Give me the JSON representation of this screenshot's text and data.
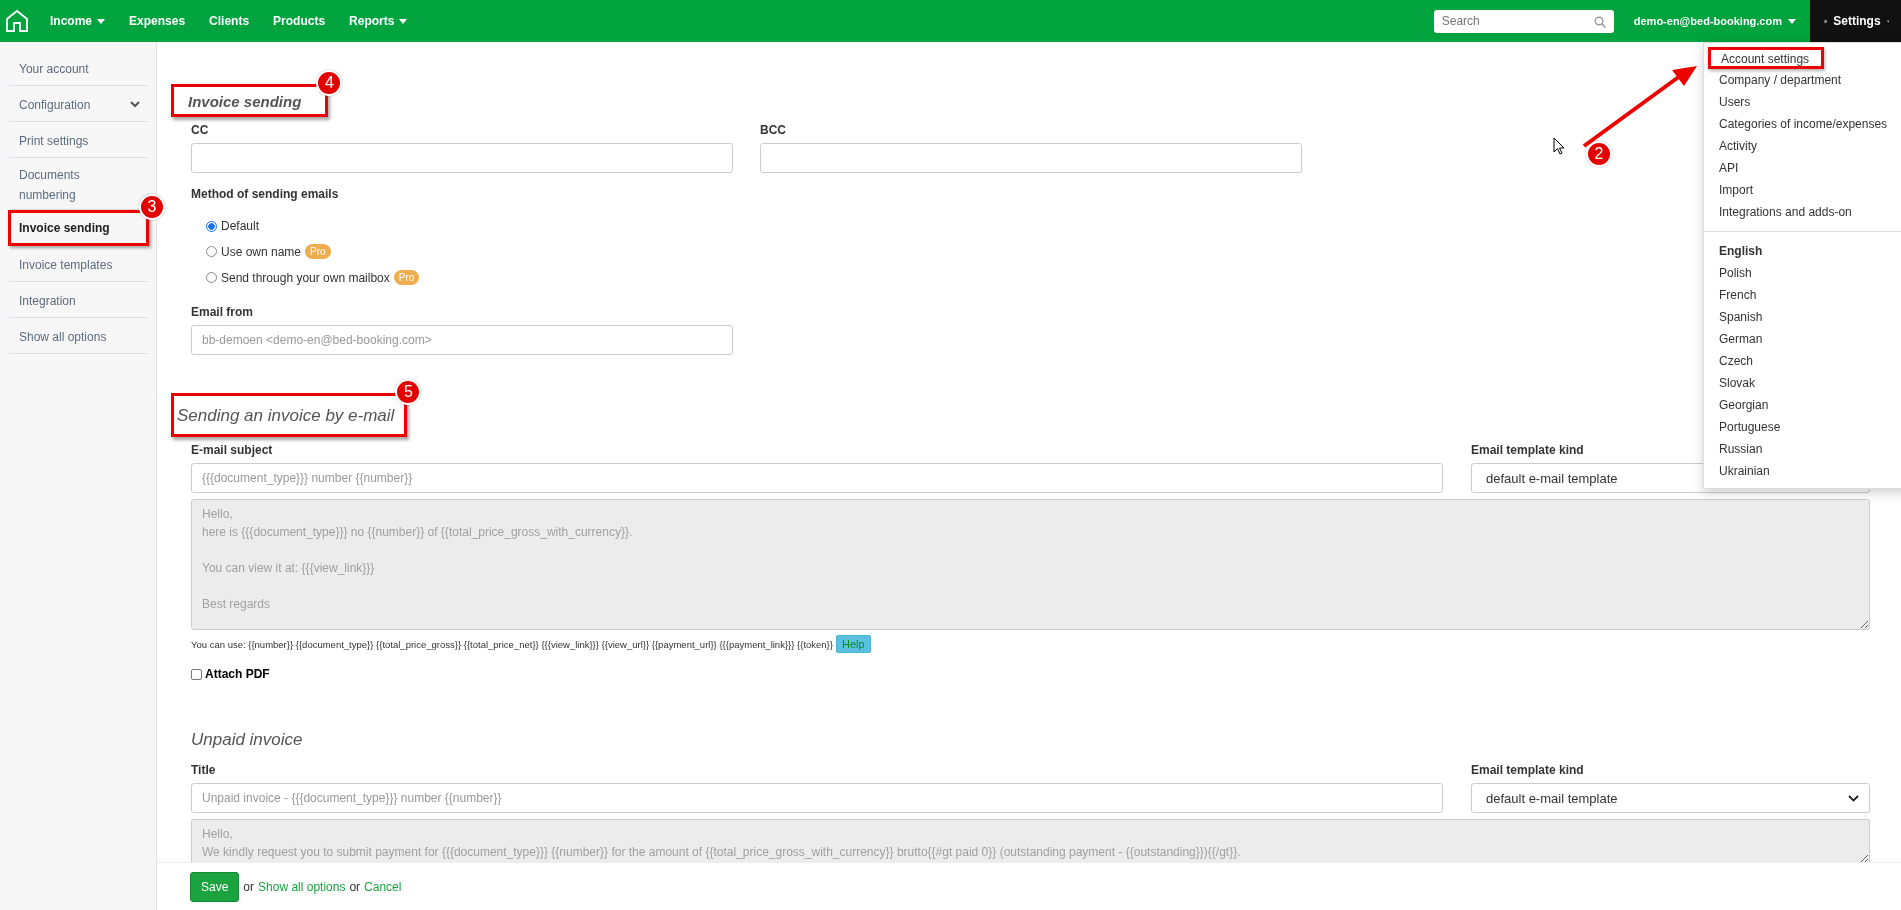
{
  "topbar": {
    "nav": [
      {
        "label": "Income",
        "has_menu": true
      },
      {
        "label": "Expenses",
        "has_menu": false
      },
      {
        "label": "Clients",
        "has_menu": false
      },
      {
        "label": "Products",
        "has_menu": false
      },
      {
        "label": "Reports",
        "has_menu": true
      }
    ],
    "search": {
      "placeholder": "Search"
    },
    "user": {
      "label": "demo-en@bed-booking.com"
    },
    "settings": {
      "label": "Settings",
      "expanded": true
    }
  },
  "settings_menu": {
    "items": [
      {
        "label": "Account settings",
        "callout": "2"
      },
      {
        "label": "Company / department"
      },
      {
        "label": "Users"
      },
      {
        "label": "Categories of income/expenses"
      },
      {
        "label": "Activity"
      },
      {
        "label": "API"
      },
      {
        "label": "Import"
      },
      {
        "label": "Integrations and adds-on"
      }
    ],
    "languages": [
      {
        "label": "English",
        "selected": true
      },
      {
        "label": "Polish",
        "selected": false
      },
      {
        "label": "French",
        "selected": false
      },
      {
        "label": "Spanish",
        "selected": false
      },
      {
        "label": "German",
        "selected": false
      },
      {
        "label": "Czech",
        "selected": false
      },
      {
        "label": "Slovak",
        "selected": false
      },
      {
        "label": "Georgian",
        "selected": false
      },
      {
        "label": "Portuguese",
        "selected": false
      },
      {
        "label": "Russian",
        "selected": false
      },
      {
        "label": "Ukrainian",
        "selected": false
      }
    ]
  },
  "sidebar": {
    "items": [
      {
        "label": "Your account",
        "kind": "link",
        "selected": false
      },
      {
        "label": "Configuration",
        "kind": "group",
        "selected": false
      },
      {
        "label": "Print settings",
        "kind": "link",
        "selected": false
      },
      {
        "label": "Documents numbering",
        "kind": "link",
        "selected": false
      },
      {
        "label": "Invoice sending",
        "kind": "link",
        "selected": true,
        "callout": "3"
      },
      {
        "label": "Invoice templates",
        "kind": "link",
        "selected": false
      },
      {
        "label": "Integration",
        "kind": "link",
        "selected": false
      },
      {
        "label": "Show all options",
        "kind": "link",
        "selected": false
      }
    ]
  },
  "invoice_sending": {
    "title": "Invoice sending",
    "callout": "4",
    "cc": {
      "label": "CC"
    },
    "bcc": {
      "label": "BCC"
    },
    "method": {
      "label": "Method of sending emails",
      "options": [
        {
          "label": "Default",
          "selected": true
        },
        {
          "label": "Use own name",
          "selected": false,
          "badge": "Pro"
        },
        {
          "label": "Send through your own mailbox",
          "selected": false,
          "badge": "Pro"
        }
      ]
    },
    "email_from": {
      "label": "Email from",
      "placeholder": "bb-demoen <demo-en@bed-booking.com>"
    }
  },
  "email_sending": {
    "title": "Sending an invoice by e-mail",
    "callout": "5",
    "subject": {
      "label": "E-mail subject",
      "placeholder": "{{{document_type}}} number {{number}}"
    },
    "template_kind": {
      "label": "Email template kind",
      "value": "default e-mail template"
    },
    "body": {
      "disabled": true,
      "paragraphs": [
        [
          "Hello,",
          "here is {{{document_type}}} no {{number}} of {{total_price_gross_with_currency}}."
        ],
        [
          "You can view it at: {{{view_link}}}"
        ],
        [
          "Best regards"
        ]
      ]
    },
    "hint": {
      "text": "You can use: {{number}} {{document_type}} {{total_price_gross}} {{total_price_net}} {{{view_link}}} {{view_url}} {{payment_url}} {{{payment_link}}} {{token}}",
      "button": "Help"
    },
    "attach_pdf": {
      "label": "Attach PDF",
      "checked": false
    }
  },
  "unpaid_invoice": {
    "title": "Unpaid invoice",
    "title_field": {
      "label": "Title",
      "placeholder": "Unpaid invoice - {{{document_type}}} number {{number}}"
    },
    "template_kind": {
      "label": "Email template kind",
      "value": "default e-mail template"
    },
    "body": {
      "disabled": true,
      "paragraphs": [
        [
          "Hello,",
          "We kindly request you to submit payment for {{{document_type}}} {{number}} for the amount of {{total_price_gross_with_currency}} brutto{{#gt paid 0}} (outstanding payment - {{outstanding}}){{/gt}}."
        ]
      ]
    }
  },
  "footer": {
    "save": "Save",
    "or_1": "or",
    "show_all": "Show all options",
    "or_2": "or",
    "cancel": "Cancel"
  }
}
